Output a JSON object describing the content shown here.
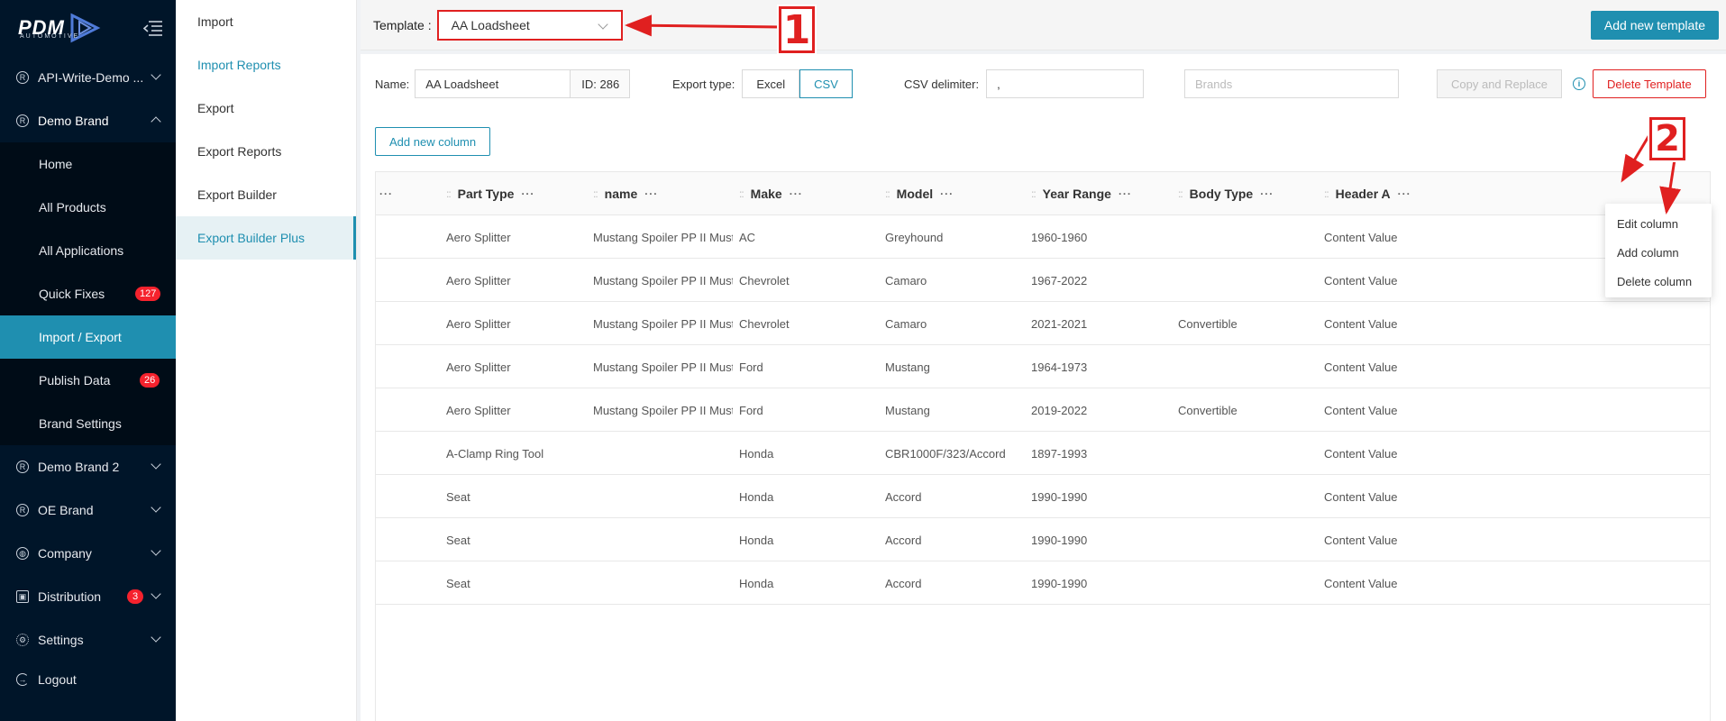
{
  "sidebar": {
    "logo": {
      "main": "PDM",
      "sub": "AUTOMOTIVE"
    },
    "items": [
      {
        "label": "API-Write-Demo ...",
        "icon": "registered-icon"
      },
      {
        "label": "Demo Brand",
        "icon": "registered-icon"
      },
      {
        "label": "Demo Brand 2",
        "icon": "registered-icon"
      },
      {
        "label": "OE Brand",
        "icon": "registered-icon"
      },
      {
        "label": "Company",
        "icon": "globe-icon"
      },
      {
        "label": "Distribution",
        "icon": "distribution-icon",
        "badge": "3"
      },
      {
        "label": "Settings",
        "icon": "gear-icon"
      },
      {
        "label": "Logout",
        "icon": "logout-icon"
      }
    ],
    "sub": [
      {
        "label": "Home"
      },
      {
        "label": "All Products"
      },
      {
        "label": "All Applications"
      },
      {
        "label": "Quick Fixes",
        "badge": "127"
      },
      {
        "label": "Import / Export"
      },
      {
        "label": "Publish Data",
        "badge": "26"
      },
      {
        "label": "Brand Settings"
      }
    ]
  },
  "subnav": [
    "Import",
    "Import Reports",
    "Export",
    "Export Reports",
    "Export Builder",
    "Export Builder Plus"
  ],
  "topbar": {
    "template_label": "Template :",
    "template_value": "AA Loadsheet",
    "add_template": "Add new template"
  },
  "form": {
    "name_label": "Name:",
    "name_value": "AA Loadsheet",
    "id": "ID: 286",
    "export_type_label": "Export type:",
    "excel": "Excel",
    "csv": "CSV",
    "delimiter_label": "CSV delimiter:",
    "delimiter_value": ",",
    "brands_placeholder": "Brands",
    "copy_replace": "Copy and Replace",
    "delete_template": "Delete Template",
    "add_column": "Add new column"
  },
  "table": {
    "first_header": "···",
    "columns": [
      "Part Type",
      "name",
      "Make",
      "Model",
      "Year Range",
      "Body Type",
      "Header A"
    ],
    "rows": [
      [
        "Aero Splitter",
        "Mustang Spoiler PP II Must...",
        "AC",
        "Greyhound",
        "1960-1960",
        "",
        "Content Value"
      ],
      [
        "Aero Splitter",
        "Mustang Spoiler PP II Must...",
        "Chevrolet",
        "Camaro",
        "1967-2022",
        "",
        "Content Value"
      ],
      [
        "Aero Splitter",
        "Mustang Spoiler PP II Must...",
        "Chevrolet",
        "Camaro",
        "2021-2021",
        "Convertible",
        "Content Value"
      ],
      [
        "Aero Splitter",
        "Mustang Spoiler PP II Must...",
        "Ford",
        "Mustang",
        "1964-1973",
        "",
        "Content Value"
      ],
      [
        "Aero Splitter",
        "Mustang Spoiler PP II Must...",
        "Ford",
        "Mustang",
        "2019-2022",
        "Convertible",
        "Content Value"
      ],
      [
        "A-Clamp Ring Tool",
        "",
        "Honda",
        "CBR1000F/323/Accord",
        "1897-1993",
        "",
        "Content Value"
      ],
      [
        "Seat",
        "",
        "Honda",
        "Accord",
        "1990-1990",
        "",
        "Content Value"
      ],
      [
        "Seat",
        "",
        "Honda",
        "Accord",
        "1990-1990",
        "",
        "Content Value"
      ],
      [
        "Seat",
        "",
        "Honda",
        "Accord",
        "1990-1990",
        "",
        "Content Value"
      ]
    ]
  },
  "dropdown": [
    "Edit column",
    "Add column",
    "Delete column"
  ],
  "callouts": [
    "1",
    "2"
  ],
  "colors": {
    "accent": "#1f8fb0",
    "sidebar": "#001529",
    "annotation": "#e02020",
    "badge": "#f5222d"
  }
}
